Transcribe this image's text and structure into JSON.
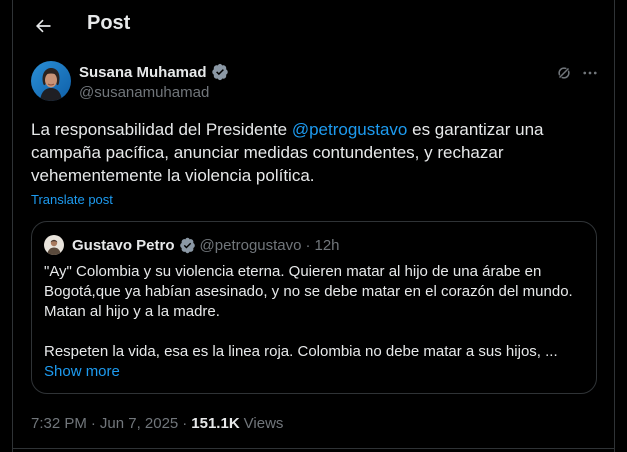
{
  "header": {
    "title": "Post"
  },
  "author": {
    "name": "Susana Muhamad",
    "handle": "@susanamuhamad",
    "verified": true
  },
  "post": {
    "text_before": "La responsabilidad del Presidente ",
    "mention": "@petrogustavo",
    "text_after": " es garantizar una campaña pacífica, anunciar medidas contundentes, y rechazar vehementemente la violencia política.",
    "translate_label": "Translate post"
  },
  "quote": {
    "name": "Gustavo Petro",
    "handle": "@petrogustavo",
    "separator": "·",
    "age": "12h",
    "paragraph1": "\"Ay\" Colombia y su violencia eterna. Quieren matar al hijo de una árabe en Bogotá,que ya habían asesinado, y no se debe matar en el corazón del mundo. Matan al hijo y a la madre.",
    "paragraph2": "Respeten la vida, esa es la linea roja. Colombia no debe matar a sus hijos, ...",
    "show_more": "Show more"
  },
  "meta": {
    "time": "7:32 PM",
    "sep1": "·",
    "date": "Jun 7, 2025",
    "sep2": "·",
    "views_count": "151.1K",
    "views_label": "Views"
  },
  "colors": {
    "background": "#000000",
    "text": "#e7e9ea",
    "muted": "#71767b",
    "accent": "#1d9bf0",
    "border": "#2f3336"
  }
}
